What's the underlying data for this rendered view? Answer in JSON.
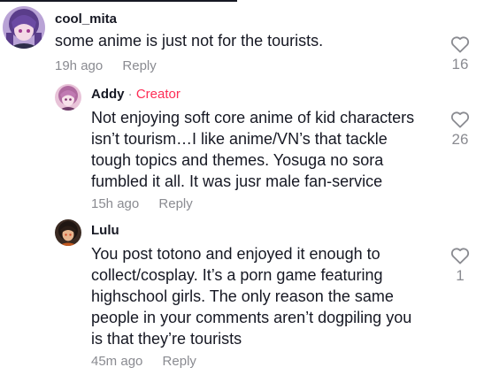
{
  "comments": [
    {
      "username": "cool_mita",
      "text_lines": [
        "some anime is just not for the tourists."
      ],
      "time": "19h ago",
      "reply_label": "Reply",
      "likes": "16",
      "avatar_icon": "anime-girl-avatar-purple"
    },
    {
      "username": "Addy",
      "separator": " · ",
      "badge": "Creator",
      "text_lines": [
        "Not enjoying soft core anime of kid characters",
        "isn’t tourism…I like anime/VN’s that tackle",
        "tough topics and themes. Yosuga no sora",
        "fumbled it all. It was jusr male fan-service"
      ],
      "time": "15h ago",
      "reply_label": "Reply",
      "likes": "26",
      "avatar_icon": "anime-girl-avatar-pink"
    },
    {
      "username": "Lulu",
      "text_lines": [
        "You post totono and enjoyed it enough to",
        "collect/cosplay. It’s a porn game featuring",
        "highschool girls. The only reason the same",
        "people in your comments aren’t dogpiling you",
        "is that they’re tourists"
      ],
      "time": "45m ago",
      "reply_label": "Reply",
      "likes": "1",
      "avatar_icon": "anime-girl-avatar-dark"
    }
  ],
  "colors": {
    "text": "#161823",
    "secondary": "#8a8b91",
    "creator_badge": "#fe2c55"
  },
  "icons": {
    "like": "heart-outline-icon"
  }
}
